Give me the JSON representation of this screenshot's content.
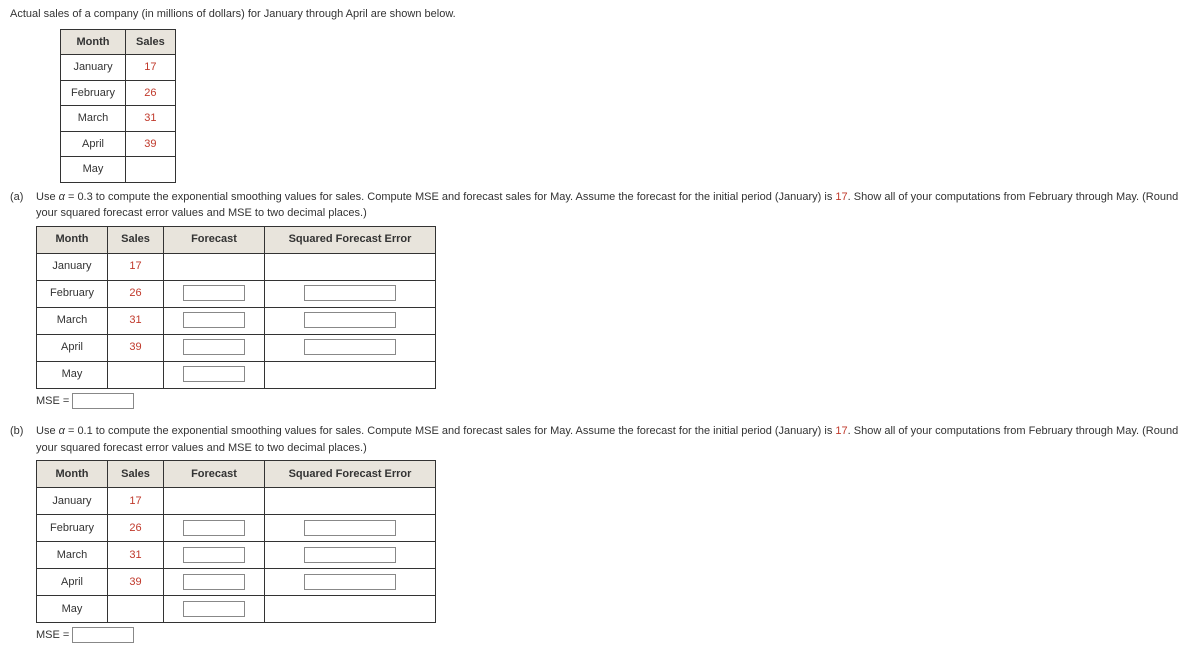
{
  "intro_text": "Actual sales of a company (in millions of dollars) for January through April are shown below.",
  "data_table": {
    "headers": {
      "month": "Month",
      "sales": "Sales"
    },
    "rows": [
      {
        "month": "January",
        "sales": "17"
      },
      {
        "month": "February",
        "sales": "26"
      },
      {
        "month": "March",
        "sales": "31"
      },
      {
        "month": "April",
        "sales": "39"
      },
      {
        "month": "May",
        "sales": ""
      }
    ]
  },
  "part_a": {
    "tag": "(a)",
    "prompt_pre": "Use ",
    "alpha_sym": "α",
    "alpha_eq": " = 0.3 to compute the exponential smoothing values for sales. Compute MSE and forecast sales for May. Assume the forecast for the initial period (January) is ",
    "hl": "17",
    "prompt_post": ". Show all of your computations from February through May. (Round your squared forecast error values and MSE to two decimal places.)"
  },
  "part_b": {
    "tag": "(b)",
    "prompt_pre": "Use ",
    "alpha_sym": "α",
    "alpha_eq": " = 0.1 to compute the exponential smoothing values for sales. Compute MSE and forecast sales for May. Assume the forecast for the initial period (January) is ",
    "hl": "17",
    "prompt_post": ". Show all of your computations from February through May. (Round your squared forecast error values and MSE to two decimal places.)"
  },
  "work_headers": {
    "month": "Month",
    "sales": "Sales",
    "forecast": "Forecast",
    "sqerr": "Squared Forecast Error"
  },
  "work_rows": [
    {
      "month": "January",
      "sales": "17",
      "forecast_input": false,
      "sqerr_input": false
    },
    {
      "month": "February",
      "sales": "26",
      "forecast_input": true,
      "sqerr_input": true
    },
    {
      "month": "March",
      "sales": "31",
      "forecast_input": true,
      "sqerr_input": true
    },
    {
      "month": "April",
      "sales": "39",
      "forecast_input": true,
      "sqerr_input": true
    },
    {
      "month": "May",
      "sales": "",
      "forecast_input": true,
      "sqerr_input": false
    }
  ],
  "mse_label": "MSE ="
}
